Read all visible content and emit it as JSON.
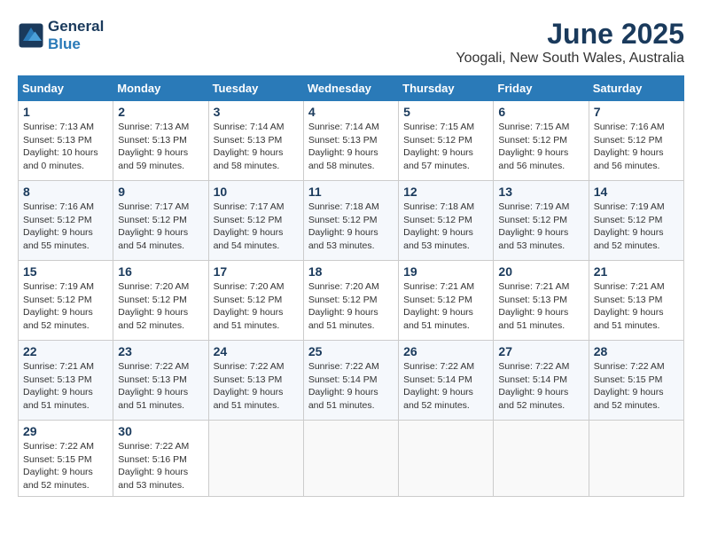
{
  "header": {
    "logo_line1": "General",
    "logo_line2": "Blue",
    "month": "June 2025",
    "location": "Yoogali, New South Wales, Australia"
  },
  "columns": [
    "Sunday",
    "Monday",
    "Tuesday",
    "Wednesday",
    "Thursday",
    "Friday",
    "Saturday"
  ],
  "weeks": [
    [
      {
        "day": "1",
        "sunrise": "Sunrise: 7:13 AM",
        "sunset": "Sunset: 5:13 PM",
        "daylight": "Daylight: 10 hours and 0 minutes."
      },
      {
        "day": "2",
        "sunrise": "Sunrise: 7:13 AM",
        "sunset": "Sunset: 5:13 PM",
        "daylight": "Daylight: 9 hours and 59 minutes."
      },
      {
        "day": "3",
        "sunrise": "Sunrise: 7:14 AM",
        "sunset": "Sunset: 5:13 PM",
        "daylight": "Daylight: 9 hours and 58 minutes."
      },
      {
        "day": "4",
        "sunrise": "Sunrise: 7:14 AM",
        "sunset": "Sunset: 5:13 PM",
        "daylight": "Daylight: 9 hours and 58 minutes."
      },
      {
        "day": "5",
        "sunrise": "Sunrise: 7:15 AM",
        "sunset": "Sunset: 5:12 PM",
        "daylight": "Daylight: 9 hours and 57 minutes."
      },
      {
        "day": "6",
        "sunrise": "Sunrise: 7:15 AM",
        "sunset": "Sunset: 5:12 PM",
        "daylight": "Daylight: 9 hours and 56 minutes."
      },
      {
        "day": "7",
        "sunrise": "Sunrise: 7:16 AM",
        "sunset": "Sunset: 5:12 PM",
        "daylight": "Daylight: 9 hours and 56 minutes."
      }
    ],
    [
      {
        "day": "8",
        "sunrise": "Sunrise: 7:16 AM",
        "sunset": "Sunset: 5:12 PM",
        "daylight": "Daylight: 9 hours and 55 minutes."
      },
      {
        "day": "9",
        "sunrise": "Sunrise: 7:17 AM",
        "sunset": "Sunset: 5:12 PM",
        "daylight": "Daylight: 9 hours and 54 minutes."
      },
      {
        "day": "10",
        "sunrise": "Sunrise: 7:17 AM",
        "sunset": "Sunset: 5:12 PM",
        "daylight": "Daylight: 9 hours and 54 minutes."
      },
      {
        "day": "11",
        "sunrise": "Sunrise: 7:18 AM",
        "sunset": "Sunset: 5:12 PM",
        "daylight": "Daylight: 9 hours and 53 minutes."
      },
      {
        "day": "12",
        "sunrise": "Sunrise: 7:18 AM",
        "sunset": "Sunset: 5:12 PM",
        "daylight": "Daylight: 9 hours and 53 minutes."
      },
      {
        "day": "13",
        "sunrise": "Sunrise: 7:19 AM",
        "sunset": "Sunset: 5:12 PM",
        "daylight": "Daylight: 9 hours and 53 minutes."
      },
      {
        "day": "14",
        "sunrise": "Sunrise: 7:19 AM",
        "sunset": "Sunset: 5:12 PM",
        "daylight": "Daylight: 9 hours and 52 minutes."
      }
    ],
    [
      {
        "day": "15",
        "sunrise": "Sunrise: 7:19 AM",
        "sunset": "Sunset: 5:12 PM",
        "daylight": "Daylight: 9 hours and 52 minutes."
      },
      {
        "day": "16",
        "sunrise": "Sunrise: 7:20 AM",
        "sunset": "Sunset: 5:12 PM",
        "daylight": "Daylight: 9 hours and 52 minutes."
      },
      {
        "day": "17",
        "sunrise": "Sunrise: 7:20 AM",
        "sunset": "Sunset: 5:12 PM",
        "daylight": "Daylight: 9 hours and 51 minutes."
      },
      {
        "day": "18",
        "sunrise": "Sunrise: 7:20 AM",
        "sunset": "Sunset: 5:12 PM",
        "daylight": "Daylight: 9 hours and 51 minutes."
      },
      {
        "day": "19",
        "sunrise": "Sunrise: 7:21 AM",
        "sunset": "Sunset: 5:12 PM",
        "daylight": "Daylight: 9 hours and 51 minutes."
      },
      {
        "day": "20",
        "sunrise": "Sunrise: 7:21 AM",
        "sunset": "Sunset: 5:13 PM",
        "daylight": "Daylight: 9 hours and 51 minutes."
      },
      {
        "day": "21",
        "sunrise": "Sunrise: 7:21 AM",
        "sunset": "Sunset: 5:13 PM",
        "daylight": "Daylight: 9 hours and 51 minutes."
      }
    ],
    [
      {
        "day": "22",
        "sunrise": "Sunrise: 7:21 AM",
        "sunset": "Sunset: 5:13 PM",
        "daylight": "Daylight: 9 hours and 51 minutes."
      },
      {
        "day": "23",
        "sunrise": "Sunrise: 7:22 AM",
        "sunset": "Sunset: 5:13 PM",
        "daylight": "Daylight: 9 hours and 51 minutes."
      },
      {
        "day": "24",
        "sunrise": "Sunrise: 7:22 AM",
        "sunset": "Sunset: 5:13 PM",
        "daylight": "Daylight: 9 hours and 51 minutes."
      },
      {
        "day": "25",
        "sunrise": "Sunrise: 7:22 AM",
        "sunset": "Sunset: 5:14 PM",
        "daylight": "Daylight: 9 hours and 51 minutes."
      },
      {
        "day": "26",
        "sunrise": "Sunrise: 7:22 AM",
        "sunset": "Sunset: 5:14 PM",
        "daylight": "Daylight: 9 hours and 52 minutes."
      },
      {
        "day": "27",
        "sunrise": "Sunrise: 7:22 AM",
        "sunset": "Sunset: 5:14 PM",
        "daylight": "Daylight: 9 hours and 52 minutes."
      },
      {
        "day": "28",
        "sunrise": "Sunrise: 7:22 AM",
        "sunset": "Sunset: 5:15 PM",
        "daylight": "Daylight: 9 hours and 52 minutes."
      }
    ],
    [
      {
        "day": "29",
        "sunrise": "Sunrise: 7:22 AM",
        "sunset": "Sunset: 5:15 PM",
        "daylight": "Daylight: 9 hours and 52 minutes."
      },
      {
        "day": "30",
        "sunrise": "Sunrise: 7:22 AM",
        "sunset": "Sunset: 5:16 PM",
        "daylight": "Daylight: 9 hours and 53 minutes."
      },
      null,
      null,
      null,
      null,
      null
    ]
  ]
}
